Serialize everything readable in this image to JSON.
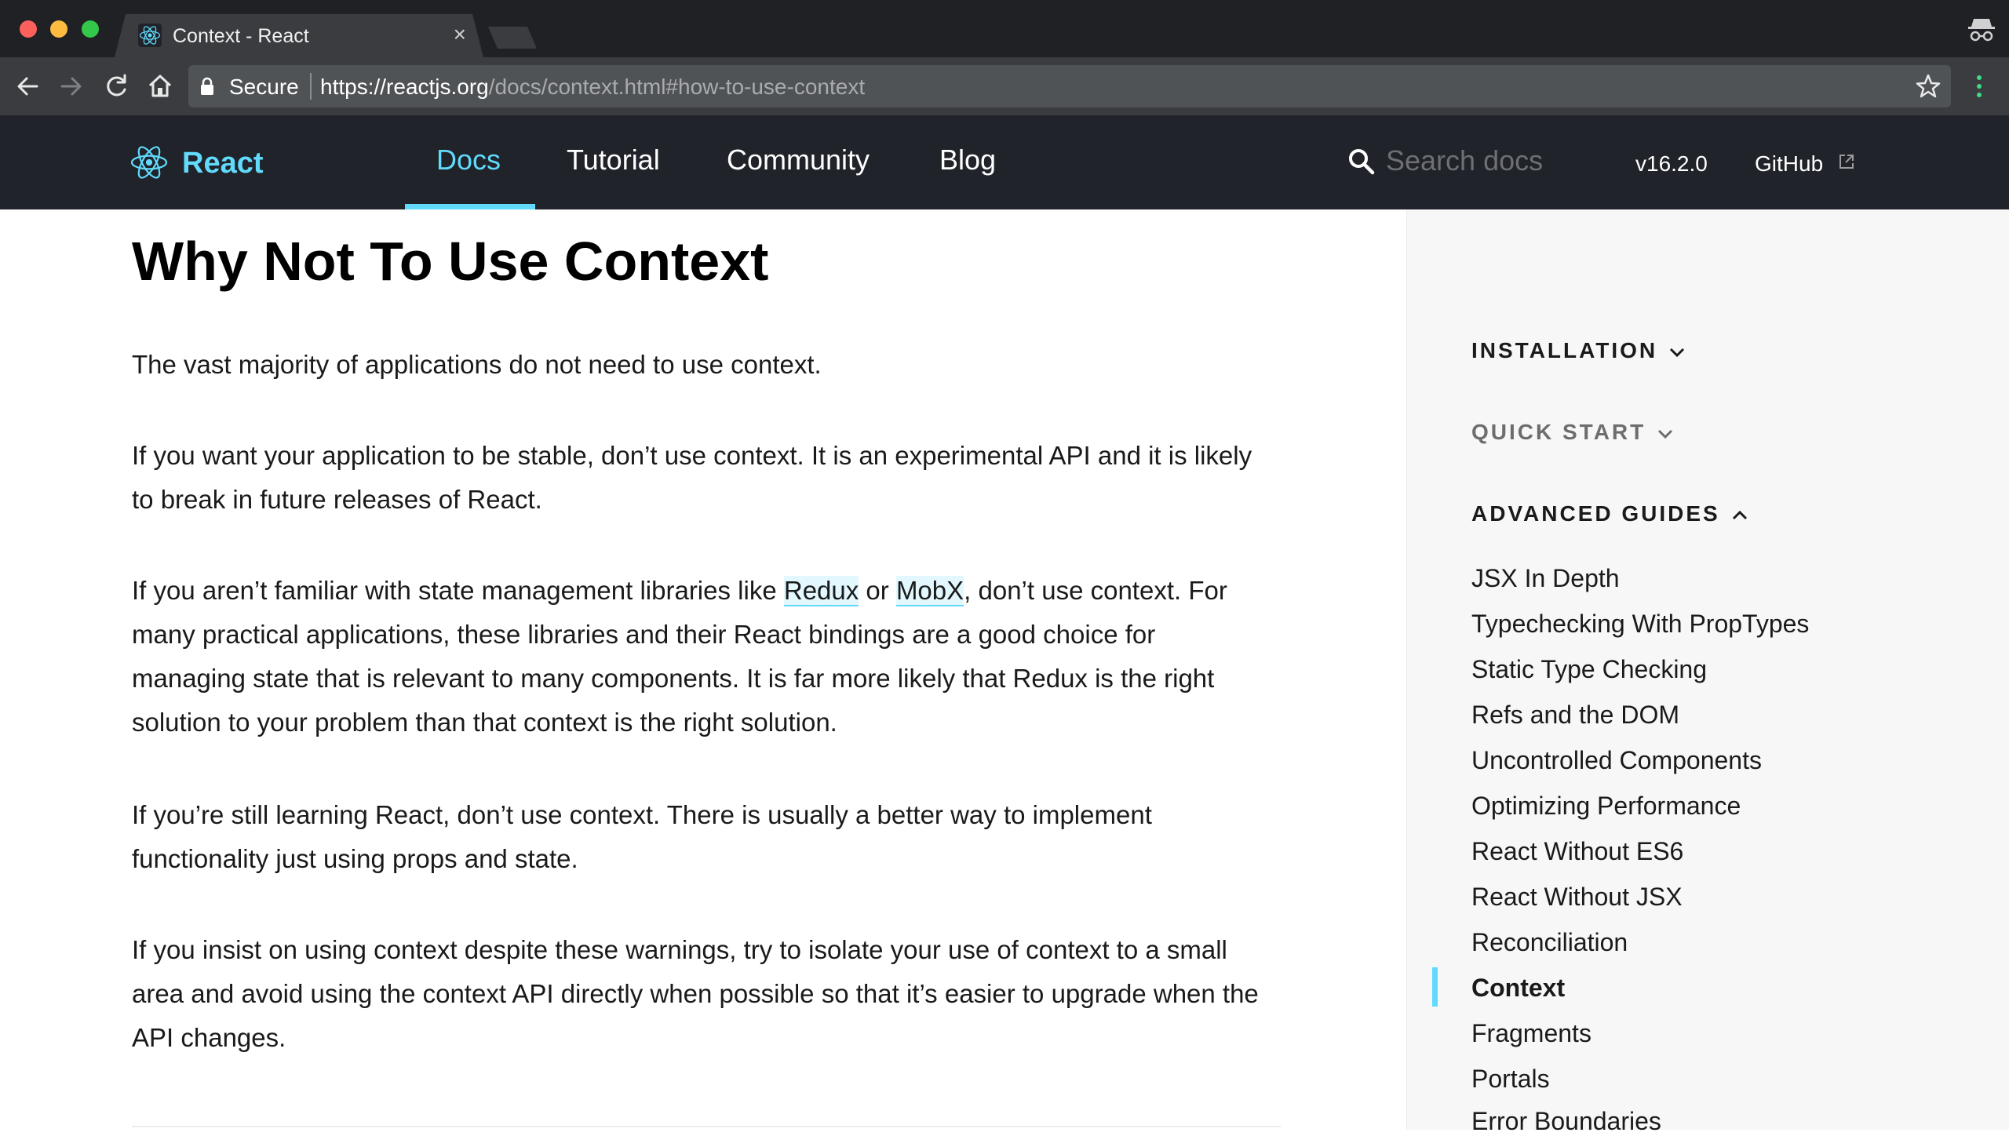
{
  "browser": {
    "tab_title": "Context - React",
    "tab_close": "×",
    "secure_label": "Secure",
    "url_origin": "https://reactjs.org",
    "url_path": "/docs/context.html#how-to-use-context"
  },
  "header": {
    "logo_text": "React",
    "nav": [
      {
        "label": "Docs",
        "active": true
      },
      {
        "label": "Tutorial",
        "active": false
      },
      {
        "label": "Community",
        "active": false
      },
      {
        "label": "Blog",
        "active": false
      }
    ],
    "search_placeholder": "Search docs",
    "version": "v16.2.0",
    "github_label": "GitHub"
  },
  "article": {
    "title": "Why Not To Use Context",
    "p1": "The vast majority of applications do not need to use context.",
    "p2": "If you want your application to be stable, don’t use context. It is an experimental API and it is likely to break in future releases of React.",
    "p3_before": "If you aren’t familiar with state management libraries like ",
    "p3_link1": "Redux",
    "p3_mid": " or ",
    "p3_link2": "MobX",
    "p3_after": ", don’t use context. For many practical applications, these libraries and their React bindings are a good choice for managing state that is relevant to many components. It is far more likely that Redux is the right solution to your problem than that context is the right solution.",
    "p4": "If you’re still learning React, don’t use context. There is usually a better way to implement functionality just using props and state.",
    "p5": "If you insist on using context despite these warnings, try to isolate your use of context to a small area and avoid using the context API directly when possible so that it’s easier to upgrade when the API changes."
  },
  "sidebar": {
    "sections": [
      {
        "label": "INSTALLATION",
        "expanded": false
      },
      {
        "label": "QUICK START",
        "expanded": false
      },
      {
        "label": "ADVANCED GUIDES",
        "expanded": true
      }
    ],
    "items": [
      {
        "label": "JSX In Depth",
        "active": false
      },
      {
        "label": "Typechecking With PropTypes",
        "active": false
      },
      {
        "label": "Static Type Checking",
        "active": false
      },
      {
        "label": "Refs and the DOM",
        "active": false
      },
      {
        "label": "Uncontrolled Components",
        "active": false
      },
      {
        "label": "Optimizing Performance",
        "active": false
      },
      {
        "label": "React Without ES6",
        "active": false
      },
      {
        "label": "React Without JSX",
        "active": false
      },
      {
        "label": "Reconciliation",
        "active": false
      },
      {
        "label": "Context",
        "active": true
      },
      {
        "label": "Fragments",
        "active": false
      },
      {
        "label": "Portals",
        "active": false
      },
      {
        "label": "Error Boundaries",
        "active": false
      }
    ]
  },
  "colors": {
    "accent": "#61dafb",
    "header_bg": "#20232a",
    "sidebar_bg": "#f7f7f7"
  },
  "icons": [
    "react-logo-icon",
    "search-icon",
    "external-link-icon",
    "lock-icon",
    "star-icon",
    "back-icon",
    "forward-icon",
    "reload-icon",
    "home-icon",
    "kebab-menu-icon",
    "incognito-icon",
    "chevron-down-icon",
    "chevron-up-icon"
  ]
}
